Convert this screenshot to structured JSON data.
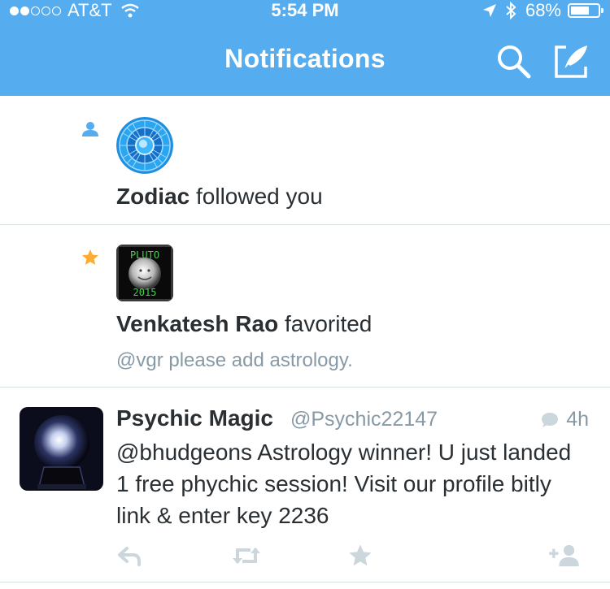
{
  "status_bar": {
    "carrier": "AT&T",
    "time": "5:54 PM",
    "battery": "68%",
    "battery_level": 0.68,
    "signal_bars_filled": 2,
    "signal_bars_total": 5
  },
  "header": {
    "title": "Notifications",
    "background_color": "#55acee",
    "icons": [
      "search-icon",
      "compose-icon"
    ]
  },
  "notifications": [
    {
      "type": "follow",
      "icon": "person-icon",
      "name": "Zodiac",
      "action": " followed you"
    },
    {
      "type": "favorite",
      "icon": "star-icon",
      "name": "Venkatesh Rao",
      "action": " favorited",
      "tweet_text": "@vgr please add astrology.",
      "avatar_text_top": "PLUTO",
      "avatar_text_bottom": "2015"
    }
  ],
  "tweet": {
    "name": "Psychic Magic",
    "handle": "@Psychic22147",
    "time": "4h",
    "text": "@bhudgeons Astrology winner! U just landed 1 free phychic session! Visit our profile bitly link & enter key 2236",
    "actions": [
      "reply-icon",
      "retweet-icon",
      "favorite-icon",
      "follow-icon"
    ]
  }
}
